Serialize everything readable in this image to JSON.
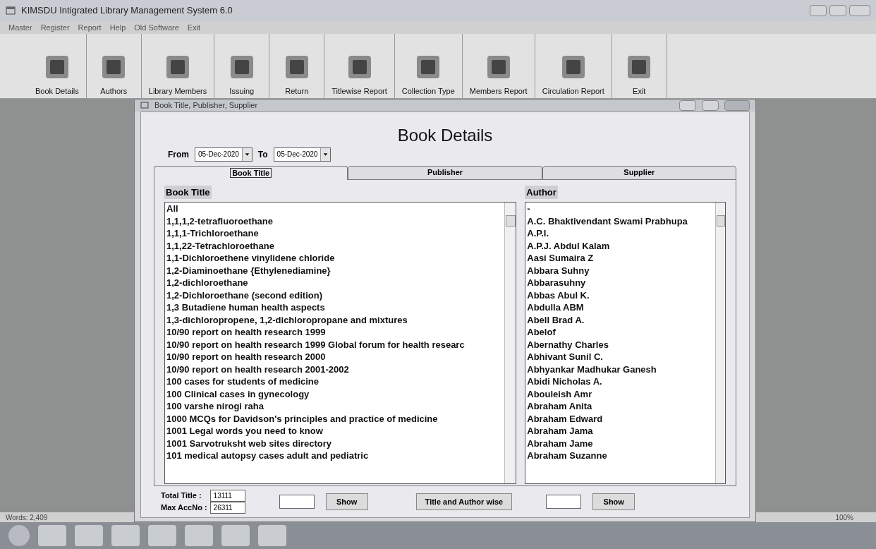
{
  "window": {
    "title": "KIMSDU Intigrated Library Management System 6.0"
  },
  "menu": [
    "Master",
    "Register",
    "Report",
    "Help",
    "Old Software",
    "Exit"
  ],
  "toolbar": [
    "Book Details",
    "Authors",
    "Library Members",
    "Issuing",
    "Return",
    "Titlewise Report",
    "Collection Type",
    "Members Report",
    "Circulation Report",
    "Exit"
  ],
  "dialog": {
    "title": "Book Title, Publisher, Supplier",
    "heading": "Book Details",
    "from_label": "From",
    "from_value": "05-Dec-2020",
    "to_label": "To",
    "to_value": "05-Dec-2020",
    "tabs": [
      {
        "label": "Book Title",
        "selected": true
      },
      {
        "label": "Publisher",
        "selected": false
      },
      {
        "label": "Supplier",
        "selected": false
      }
    ],
    "book_title_label": "Book Title",
    "book_titles": [
      "All",
      "1,1,1,2-tetrafluoroethane",
      "1,1,1-Trichloroethane",
      "1,1,22-Tetrachloroethane",
      "1,1-Dichloroethene vinylidene chloride",
      "1,2-Diaminoethane {Ethylenediamine}",
      "1,2-dichloroethane",
      "1,2-Dichloroethane (second edition)",
      "1,3 Butadiene human health aspects",
      "1,3-dichloropropene, 1,2-dichloropropane and mixtures",
      "10/90 report on health research 1999",
      "10/90 report on health research 1999 Global forum for health researc",
      "10/90 report on health research 2000",
      "10/90 report on health research 2001-2002",
      "100 cases for students of medicine",
      "100 Clinical cases in gynecology",
      "100 varshe nirogi raha",
      "1000 MCQs for Davidson's principles and practice of medicine",
      "1001 Legal words you need to know",
      "1001 Sarvotruksht web sites directory",
      "101 medical autopsy cases adult and pediatric"
    ],
    "author_label": "Author",
    "authors": [
      "-",
      "A.C. Bhaktivendant Swami Prabhupa",
      "A.P.I.",
      "A.P.J. Abdul Kalam",
      "Aasi Sumaira Z",
      "Abbara Suhny",
      "Abbarasuhny",
      "Abbas Abul K.",
      "Abdulla ABM",
      "Abell Brad A.",
      "Abelof",
      "Abernathy Charles",
      "Abhivant Sunil C.",
      "Abhyankar Madhukar Ganesh",
      "Abidi Nicholas A.",
      "Abouleish Amr",
      "Abraham Anita",
      "Abraham Edward",
      "Abraham Jama",
      "Abraham Jame",
      "Abraham Suzanne"
    ],
    "total_title_label": "Total Title :",
    "total_title": "13111",
    "max_accno_label": "Max AccNo :",
    "max_accno": "26311",
    "show_button_left": "Show",
    "title_author_button": "Title and Author wise",
    "show_button_right": "Show"
  },
  "status_bar": {
    "words": "Words: 2,409",
    "zoom": "100%"
  }
}
